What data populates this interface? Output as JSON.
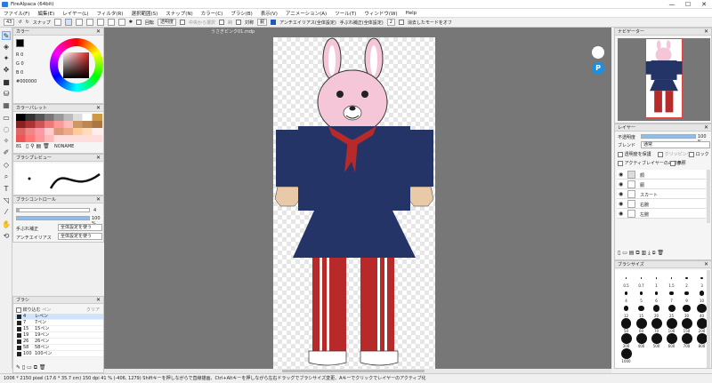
{
  "window": {
    "title": "FireAlpaca (64bit)",
    "min": "—",
    "max": "☐",
    "close": "✕"
  },
  "menu": [
    "ファイル(F)",
    "編集(E)",
    "レイヤー(L)",
    "フィルタ(R)",
    "選択範囲(S)",
    "スナップ(N)",
    "カラー(C)",
    "ブラシ(B)",
    "表示(V)",
    "アニメーション(A)",
    "ツール(T)",
    "ウィンドウ(W)",
    "Help"
  ],
  "toolbar": {
    "zoom": "43",
    "snap_label": "スナップ",
    "antialias_label": "アンチエイリアス(全体設定)",
    "stabilizer_label": "手ぶれ補正(全体設定)",
    "stabilizer_value": "2",
    "mirror_label": "消去したモードをオフ",
    "opt1": "回転",
    "opt2": "中央から選択",
    "opt3": "鈍",
    "opt4": "対称",
    "opt5": "鋭",
    "opt6": "透明度",
    "opt7": "ふちどりモードを保存",
    "opt8": "指定場所を固定しておく"
  },
  "color_panel": {
    "title": "カラー",
    "r": "R 0",
    "g": "G 0",
    "b": "B 0",
    "hex": "#000000"
  },
  "palette_panel": {
    "title": "カラーパレット",
    "name": "NONAME",
    "count": "81"
  },
  "brush_preview": {
    "title": "ブラシプレビュー"
  },
  "brush_control": {
    "title": "ブラシコントロール",
    "size": "4",
    "opacity": "100 %",
    "stab_label": "手ぶれ補正",
    "stab_value": "全体設定を使う",
    "aa_label": "アンチエイリアス",
    "aa_value": "全体設定を使う"
  },
  "brush_panel": {
    "title": "ブラシ",
    "tab1": "絞り込む",
    "tab2": "ペン",
    "clear": "クリア",
    "items": [
      {
        "size": "4",
        "name": "レペン"
      },
      {
        "size": "7",
        "name": "7ペン"
      },
      {
        "size": "15",
        "name": "15ペン"
      },
      {
        "size": "19",
        "name": "19ペン"
      },
      {
        "size": "26",
        "name": "26ペン"
      },
      {
        "size": "58",
        "name": "58ペン"
      },
      {
        "size": "100",
        "name": "100ペン"
      }
    ]
  },
  "document": {
    "tab": "うさぎピンク01.mdp"
  },
  "navigator": {
    "title": "ナビゲーター"
  },
  "layer_panel": {
    "title": "レイヤー",
    "opacity_label": "不透明度",
    "opacity_value": "100 %",
    "blend_label": "ブレンド",
    "blend_value": "通常",
    "protect": "透明度を保護",
    "clipping": "クリッピング",
    "lock": "ロック",
    "active_only": "アクティブレイヤーのみ表示",
    "reference": "参照",
    "layers": [
      "顔",
      "胴",
      "スカート",
      "右腕",
      "左腕"
    ]
  },
  "brush_size_panel": {
    "title": "ブラシサイズ",
    "sizes": [
      "0.5",
      "0.7",
      "1",
      "1.5",
      "2",
      "3",
      "4",
      "5",
      "6",
      "7",
      "9",
      "10",
      "12",
      "15",
      "20",
      "25",
      "30",
      "40",
      "50",
      "60",
      "70",
      "100",
      "150",
      "200",
      "300",
      "400",
      "500",
      "600",
      "700",
      "800",
      "1000"
    ]
  },
  "status": {
    "text": "1006 * 2150 pixel   (17.6 * 35.7 cm)   150 dpi   41 %   (-406, 1279)   Shiftキーを押しながらで直線描画、Ctrl+Altキーを押しながら左右ドラッグでブラシサイズ変更、Aキーでクリックでレイヤーのアクティブ化"
  },
  "colors": {
    "accent": "#1e5bb8",
    "navy": "#243467",
    "red": "#b82a2a",
    "pink": "#f5c6d8"
  }
}
